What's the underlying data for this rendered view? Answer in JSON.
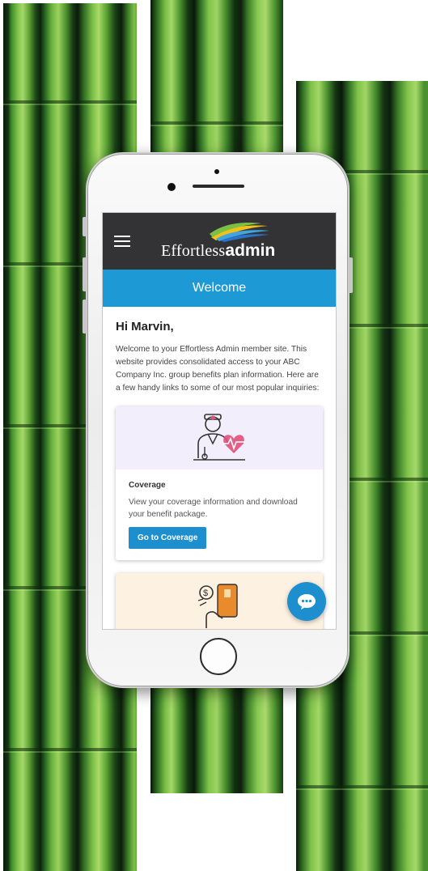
{
  "app": {
    "brand": {
      "name_light": "Effortless",
      "name_bold": "admin"
    },
    "page_title": "Welcome"
  },
  "main": {
    "greeting": "Hi Marvin,",
    "intro": "Welcome to your Effortless Admin member site. This website provides consolidated access to your ABC Company Inc. group benefits plan information. Here are a few handy links to some of our most popular inquiries:",
    "cards": [
      {
        "icon": "doctor-heart-icon",
        "title": "Coverage",
        "description": "View your coverage information and download your benefit package.",
        "button_label": "Go to Coverage"
      },
      {
        "icon": "hand-card-dollar-icon"
      }
    ]
  },
  "colors": {
    "header_bg": "#333336",
    "accent_blue": "#1d9ad6",
    "button_blue": "#1d8fcf",
    "card1_hero": "#f3eefb",
    "card2_hero": "#fdf1e2",
    "heart_pink": "#e0507a",
    "card_orange": "#e98a2c"
  },
  "icons": {
    "menu": "hamburger-menu-icon",
    "chat": "chat-bubble-icon"
  }
}
